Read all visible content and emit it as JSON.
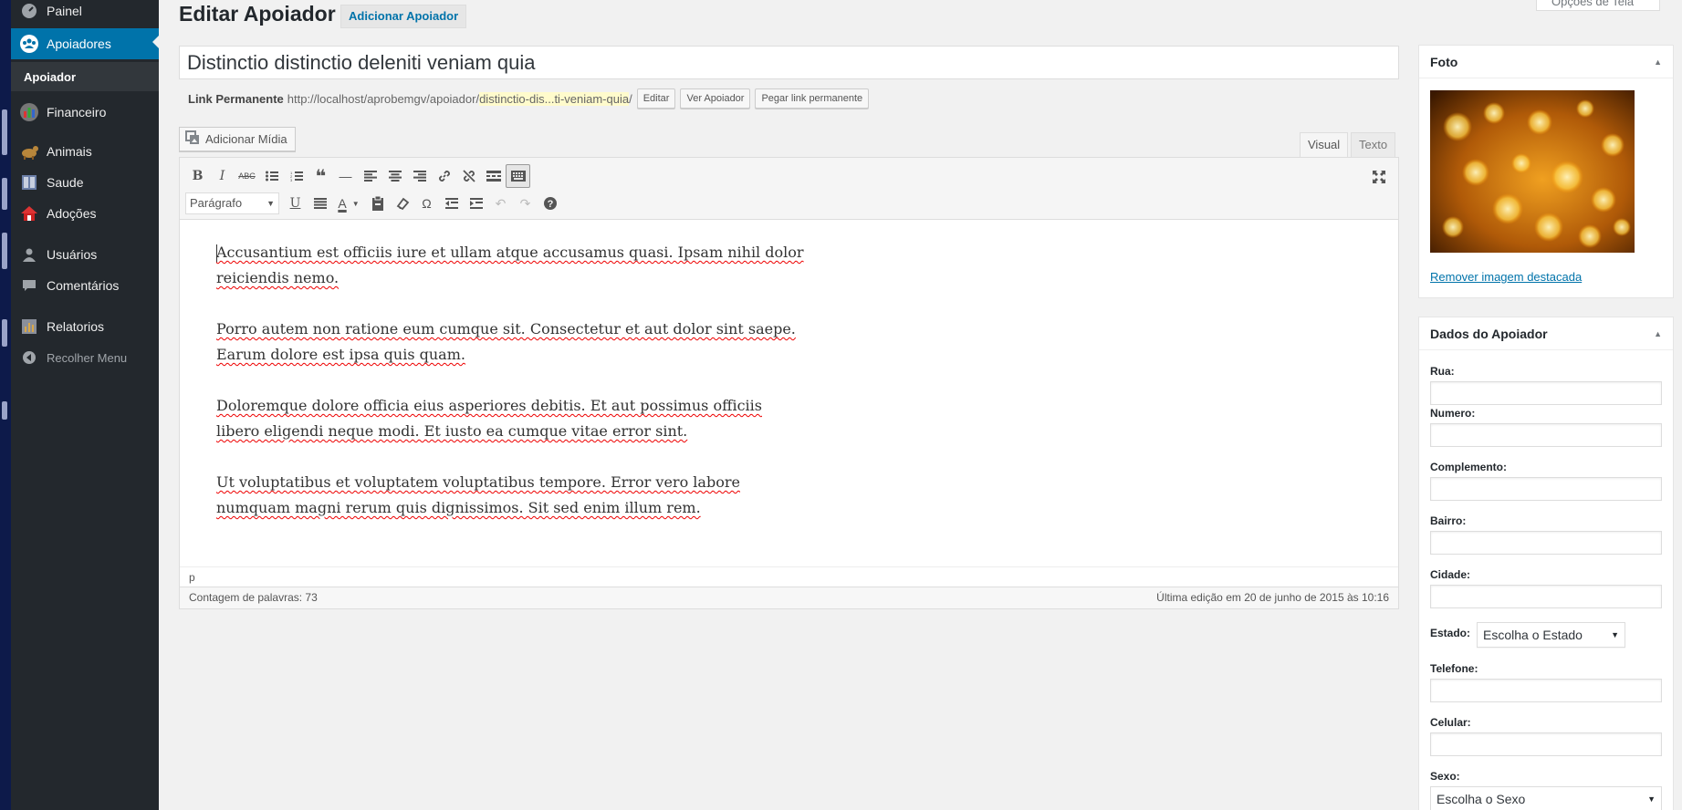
{
  "sidebar": {
    "items": [
      {
        "label": "Painel",
        "icon": "dashboard-icon"
      },
      {
        "label": "Apoiadores",
        "icon": "groups-icon"
      },
      {
        "label": "Financeiro",
        "icon": "chart-icon"
      },
      {
        "label": "Animais",
        "icon": "animal-icon"
      },
      {
        "label": "Saude",
        "icon": "health-icon"
      },
      {
        "label": "Adoções",
        "icon": "house-icon"
      },
      {
        "label": "Usuários",
        "icon": "user-icon"
      },
      {
        "label": "Comentários",
        "icon": "comment-icon"
      },
      {
        "label": "Relatorios",
        "icon": "report-icon"
      },
      {
        "label": "Recolher Menu",
        "icon": "collapse-icon"
      }
    ],
    "submenu": "Apoiador",
    "active_color": "#0073aa"
  },
  "header": {
    "title": "Editar Apoiador",
    "add_new": "Adicionar Apoiador",
    "screen_options": "Opções de Tela"
  },
  "post": {
    "title": "Distinctio distinctio deleniti veniam quia",
    "permalink_label": "Link Permanente",
    "permalink_base": "http://localhost/aprobemgv/apoiador/",
    "permalink_slug": "distinctio-dis...ti-veniam-quia",
    "permalink_end": "/",
    "edit_btn": "Editar",
    "view_btn": "Ver Apoiador",
    "shortlink_btn": "Pegar link permanente"
  },
  "editor": {
    "add_media": "Adicionar Mídia",
    "tab_visual": "Visual",
    "tab_text": "Texto",
    "format": "Parágrafo",
    "paragraphs": [
      "Accusantium est officiis iure et ullam atque accusamus quasi. Ipsam nihil dolor reiciendis nemo.",
      "Porro autem non ratione eum cumque sit. Consectetur et aut dolor sint saepe. Earum dolore est ipsa quis quam.",
      "Doloremque dolore officia eius asperiores debitis. Et aut possimus officiis libero eligendi neque modi. Et iusto ea cumque vitae error sint.",
      "Ut voluptatibus et voluptatem voluptatibus tempore. Error vero labore numquam magni rerum quis dignissimos. Sit sed enim illum rem."
    ],
    "path": "p",
    "word_count": "Contagem de palavras: 73",
    "last_edit": "Última edição em 20 de junho de 2015 às 10:16"
  },
  "foto_box": {
    "title": "Foto",
    "remove_link": "Remover imagem destacada"
  },
  "dados_box": {
    "title": "Dados do Apoiador",
    "rua": "Rua:",
    "numero": "Numero:",
    "complemento": "Complemento:",
    "bairro": "Bairro:",
    "cidade": "Cidade:",
    "estado": "Estado:",
    "estado_value": "Escolha o Estado",
    "telefone": "Telefone:",
    "celular": "Celular:",
    "sexo": "Sexo:",
    "sexo_value": "Escolha o Sexo"
  }
}
